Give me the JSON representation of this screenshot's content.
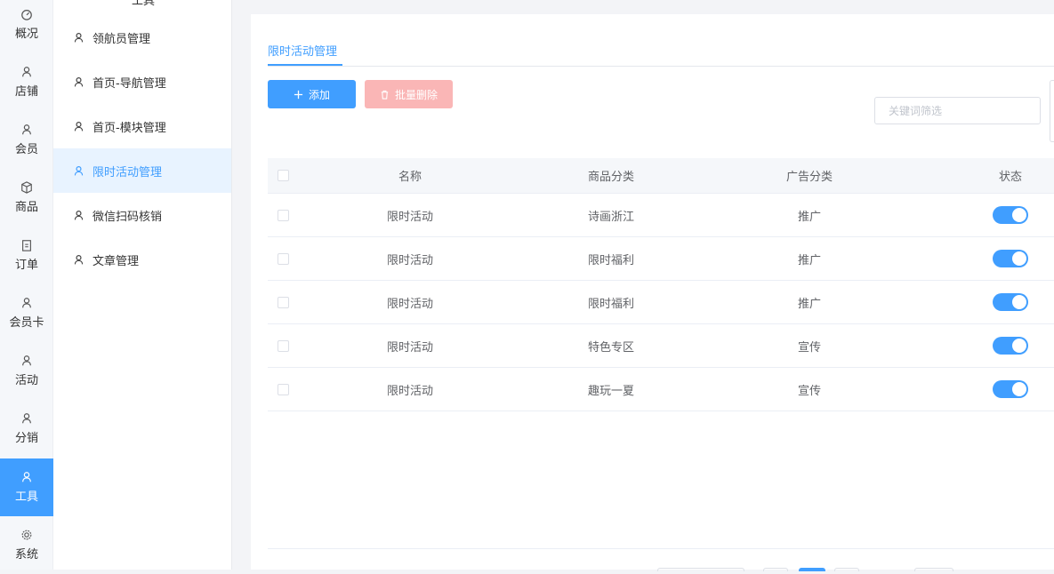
{
  "rail": {
    "items": [
      {
        "label": "概况",
        "icon": "dashboard-icon"
      },
      {
        "label": "店铺",
        "icon": "user-icon"
      },
      {
        "label": "会员",
        "icon": "user-icon"
      },
      {
        "label": "商品",
        "icon": "box-icon"
      },
      {
        "label": "订单",
        "icon": "clipboard-icon"
      },
      {
        "label": "会员卡",
        "icon": "user-icon"
      },
      {
        "label": "活动",
        "icon": "user-icon"
      },
      {
        "label": "分销",
        "icon": "user-icon"
      },
      {
        "label": "工具",
        "icon": "user-icon",
        "active": true
      },
      {
        "label": "系统",
        "icon": "gear-icon"
      }
    ]
  },
  "subnav": {
    "top_partial": "工具",
    "items": [
      {
        "label": "领航员管理"
      },
      {
        "label": "首页-导航管理"
      },
      {
        "label": "首页-模块管理"
      },
      {
        "label": "限时活动管理",
        "active": true
      },
      {
        "label": "微信扫码核销"
      },
      {
        "label": "文章管理"
      }
    ]
  },
  "main": {
    "tab_label": "限时活动管理",
    "add_label": "添加",
    "batch_delete_label": "批量删除",
    "search_placeholder": "关键词筛选",
    "table": {
      "headers": {
        "name": "名称",
        "category": "商品分类",
        "ad_category": "广告分类",
        "status": "状态"
      },
      "rows": [
        {
          "name": "限时活动",
          "category": "诗画浙江",
          "ad_category": "推广",
          "status_on": true
        },
        {
          "name": "限时活动",
          "category": "限时福利",
          "ad_category": "推广",
          "status_on": true
        },
        {
          "name": "限时活动",
          "category": "限时福利",
          "ad_category": "推广",
          "status_on": true
        },
        {
          "name": "限时活动",
          "category": "特色专区",
          "ad_category": "宣传",
          "status_on": true
        },
        {
          "name": "限时活动",
          "category": "趣玩一夏",
          "ad_category": "宣传",
          "status_on": true
        }
      ]
    }
  },
  "colors": {
    "accent": "#409eff",
    "danger_disabled": "#fab6b6",
    "active_bg": "#e8f3ff"
  }
}
